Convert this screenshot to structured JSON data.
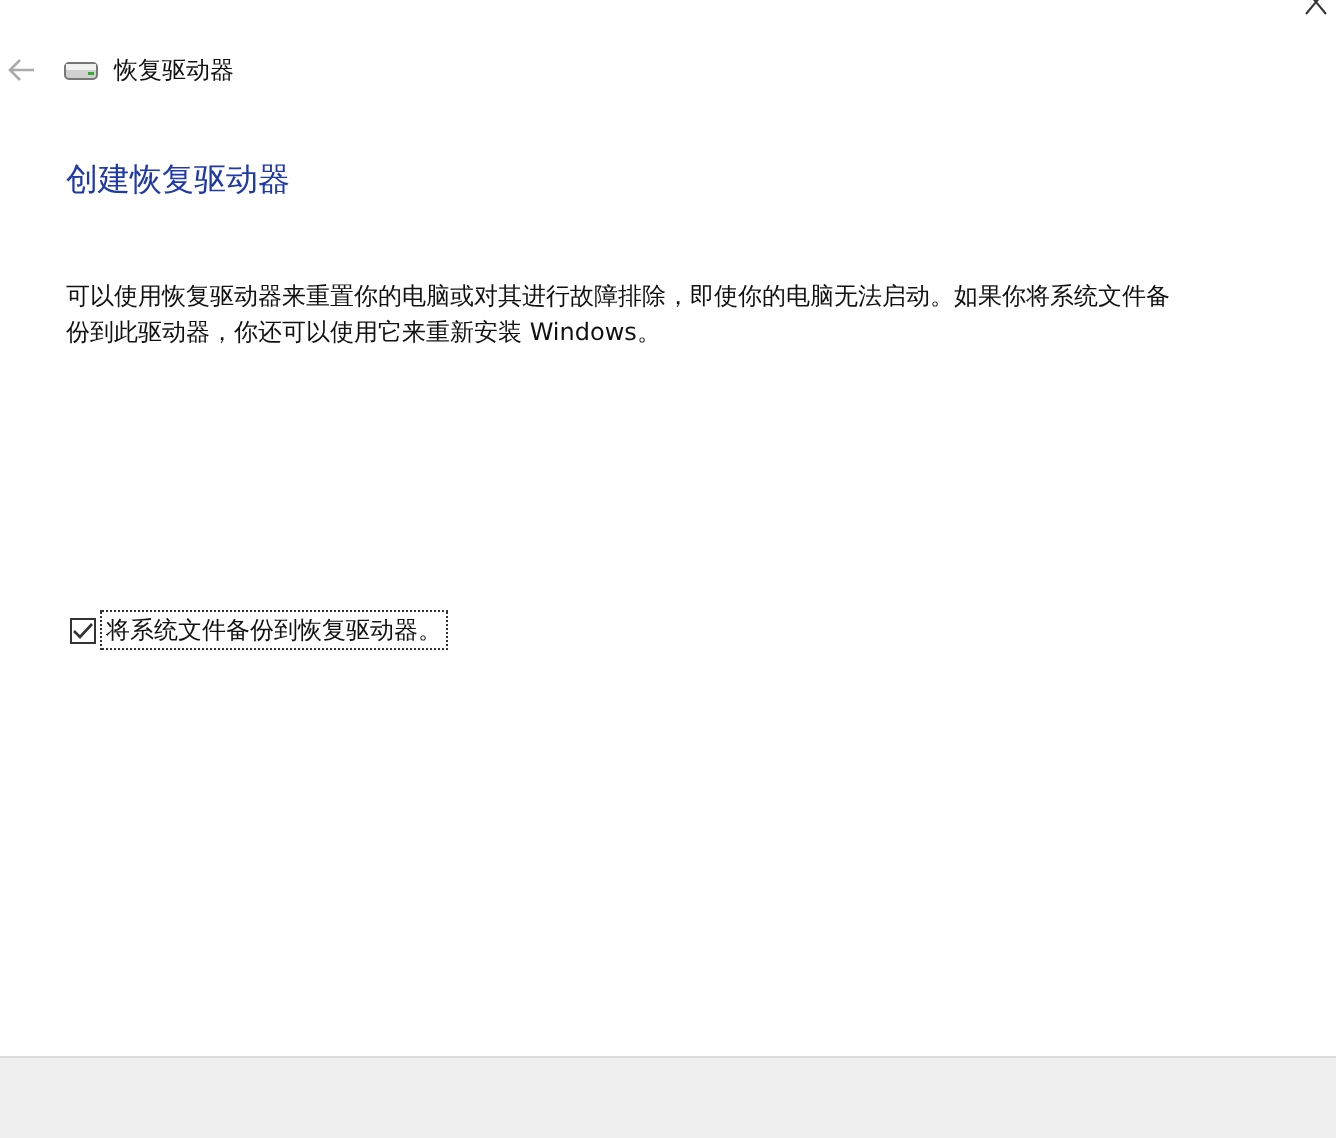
{
  "window": {
    "title": "恢复驱动器"
  },
  "heading": "创建恢复驱动器",
  "description": "可以使用恢复驱动器来重置你的电脑或对其进行故障排除，即使你的电脑无法启动。如果你将系统文件备份到此驱动器，你还可以使用它来重新安装 Windows。",
  "options": [
    {
      "label": "将系统文件备份到恢复驱动器。",
      "checked": true
    }
  ]
}
